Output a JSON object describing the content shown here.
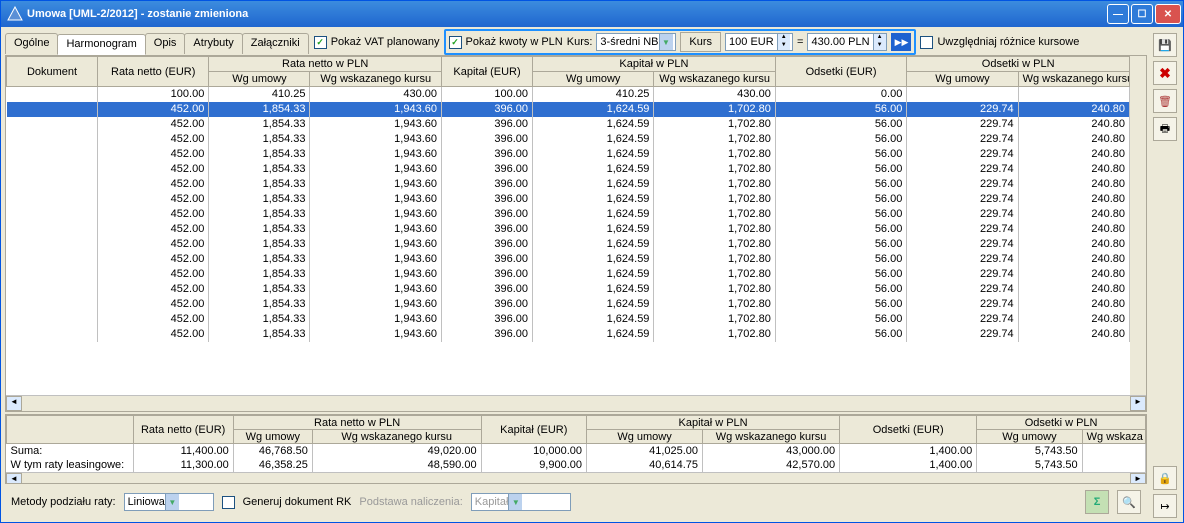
{
  "window": {
    "title": "Umowa [UML-2/2012] - zostanie zmieniona"
  },
  "tabs": [
    "Ogólne",
    "Harmonogram",
    "Opis",
    "Atrybuty",
    "Załączniki"
  ],
  "activeTab": 1,
  "options": {
    "pokaz_vat_label": "Pokaż VAT planowany",
    "pokaz_kwoty_label": "Pokaż kwoty w PLN",
    "kurs_label": "Kurs:",
    "kurs_type": "3-średni NB",
    "kurs_btn": "Kurs",
    "eur_value": "100 EUR",
    "pln_value": "430.00 PLN",
    "uwzgl_label": "Uwzględniaj różnice kursowe"
  },
  "headers": {
    "dokument": "Dokument",
    "rneur": "Rata netto (EUR)",
    "rnpln": "Rata netto w PLN",
    "keur": "Kapitał (EUR)",
    "kpln": "Kapitał w PLN",
    "oeur": "Odsetki (EUR)",
    "opln": "Odsetki w PLN",
    "umowy": "Wg umowy",
    "wsk": "Wg wskazanego kursu"
  },
  "rows": [
    {
      "rneur": "100.00",
      "rnpln1": "410.25",
      "rnpln2": "430.00",
      "keur": "100.00",
      "kpln1": "410.25",
      "kpln2": "430.00",
      "oeur": "0.00",
      "opln1": "",
      "opln2": ""
    },
    {
      "rneur": "452.00",
      "rnpln1": "1,854.33",
      "rnpln2": "1,943.60",
      "keur": "396.00",
      "kpln1": "1,624.59",
      "kpln2": "1,702.80",
      "oeur": "56.00",
      "opln1": "229.74",
      "opln2": "240.80",
      "sel": true
    },
    {
      "rneur": "452.00",
      "rnpln1": "1,854.33",
      "rnpln2": "1,943.60",
      "keur": "396.00",
      "kpln1": "1,624.59",
      "kpln2": "1,702.80",
      "oeur": "56.00",
      "opln1": "229.74",
      "opln2": "240.80"
    },
    {
      "rneur": "452.00",
      "rnpln1": "1,854.33",
      "rnpln2": "1,943.60",
      "keur": "396.00",
      "kpln1": "1,624.59",
      "kpln2": "1,702.80",
      "oeur": "56.00",
      "opln1": "229.74",
      "opln2": "240.80"
    },
    {
      "rneur": "452.00",
      "rnpln1": "1,854.33",
      "rnpln2": "1,943.60",
      "keur": "396.00",
      "kpln1": "1,624.59",
      "kpln2": "1,702.80",
      "oeur": "56.00",
      "opln1": "229.74",
      "opln2": "240.80"
    },
    {
      "rneur": "452.00",
      "rnpln1": "1,854.33",
      "rnpln2": "1,943.60",
      "keur": "396.00",
      "kpln1": "1,624.59",
      "kpln2": "1,702.80",
      "oeur": "56.00",
      "opln1": "229.74",
      "opln2": "240.80"
    },
    {
      "rneur": "452.00",
      "rnpln1": "1,854.33",
      "rnpln2": "1,943.60",
      "keur": "396.00",
      "kpln1": "1,624.59",
      "kpln2": "1,702.80",
      "oeur": "56.00",
      "opln1": "229.74",
      "opln2": "240.80"
    },
    {
      "rneur": "452.00",
      "rnpln1": "1,854.33",
      "rnpln2": "1,943.60",
      "keur": "396.00",
      "kpln1": "1,624.59",
      "kpln2": "1,702.80",
      "oeur": "56.00",
      "opln1": "229.74",
      "opln2": "240.80"
    },
    {
      "rneur": "452.00",
      "rnpln1": "1,854.33",
      "rnpln2": "1,943.60",
      "keur": "396.00",
      "kpln1": "1,624.59",
      "kpln2": "1,702.80",
      "oeur": "56.00",
      "opln1": "229.74",
      "opln2": "240.80"
    },
    {
      "rneur": "452.00",
      "rnpln1": "1,854.33",
      "rnpln2": "1,943.60",
      "keur": "396.00",
      "kpln1": "1,624.59",
      "kpln2": "1,702.80",
      "oeur": "56.00",
      "opln1": "229.74",
      "opln2": "240.80"
    },
    {
      "rneur": "452.00",
      "rnpln1": "1,854.33",
      "rnpln2": "1,943.60",
      "keur": "396.00",
      "kpln1": "1,624.59",
      "kpln2": "1,702.80",
      "oeur": "56.00",
      "opln1": "229.74",
      "opln2": "240.80"
    },
    {
      "rneur": "452.00",
      "rnpln1": "1,854.33",
      "rnpln2": "1,943.60",
      "keur": "396.00",
      "kpln1": "1,624.59",
      "kpln2": "1,702.80",
      "oeur": "56.00",
      "opln1": "229.74",
      "opln2": "240.80"
    },
    {
      "rneur": "452.00",
      "rnpln1": "1,854.33",
      "rnpln2": "1,943.60",
      "keur": "396.00",
      "kpln1": "1,624.59",
      "kpln2": "1,702.80",
      "oeur": "56.00",
      "opln1": "229.74",
      "opln2": "240.80"
    },
    {
      "rneur": "452.00",
      "rnpln1": "1,854.33",
      "rnpln2": "1,943.60",
      "keur": "396.00",
      "kpln1": "1,624.59",
      "kpln2": "1,702.80",
      "oeur": "56.00",
      "opln1": "229.74",
      "opln2": "240.80"
    },
    {
      "rneur": "452.00",
      "rnpln1": "1,854.33",
      "rnpln2": "1,943.60",
      "keur": "396.00",
      "kpln1": "1,624.59",
      "kpln2": "1,702.80",
      "oeur": "56.00",
      "opln1": "229.74",
      "opln2": "240.80"
    },
    {
      "rneur": "452.00",
      "rnpln1": "1,854.33",
      "rnpln2": "1,943.60",
      "keur": "396.00",
      "kpln1": "1,624.59",
      "kpln2": "1,702.80",
      "oeur": "56.00",
      "opln1": "229.74",
      "opln2": "240.80"
    },
    {
      "rneur": "452.00",
      "rnpln1": "1,854.33",
      "rnpln2": "1,943.60",
      "keur": "396.00",
      "kpln1": "1,624.59",
      "kpln2": "1,702.80",
      "oeur": "56.00",
      "opln1": "229.74",
      "opln2": "240.80"
    }
  ],
  "summary_headers": {
    "rneur": "Rata netto (EUR)",
    "rnpln": "Rata netto w PLN",
    "keur": "Kapitał (EUR)",
    "kpln": "Kapitał w PLN",
    "oeur": "Odsetki (EUR)",
    "opln": "Odsetki w PLN",
    "umowy": "Wg umowy",
    "wsk": "Wg wskazanego kursu",
    "wsk_short": "Wg wskaza"
  },
  "summary": [
    {
      "label": "Suma:",
      "rneur": "11,400.00",
      "rnpln1": "46,768.50",
      "rnpln2": "49,020.00",
      "keur": "10,000.00",
      "kpln1": "41,025.00",
      "kpln2": "43,000.00",
      "oeur": "1,400.00",
      "opln1": "5,743.50",
      "opln2": ""
    },
    {
      "label": "W tym raty leasingowe:",
      "rneur": "11,300.00",
      "rnpln1": "46,358.25",
      "rnpln2": "48,590.00",
      "keur": "9,900.00",
      "kpln1": "40,614.75",
      "kpln2": "42,570.00",
      "oeur": "1,400.00",
      "opln1": "5,743.50",
      "opln2": ""
    }
  ],
  "bottom": {
    "metody_label": "Metody podziału raty:",
    "metody_value": "Liniowa",
    "generuj_label": "Generuj dokument RK",
    "podstawa_label": "Podstawa naliczenia:",
    "podstawa_value": "Kapitał"
  },
  "icons": {
    "save": "💾",
    "delete": "✖",
    "trash": "🗑",
    "print": "🖶",
    "lock": "🔒",
    "sigma": "Σ",
    "search": "🔍",
    "exit": "↦"
  }
}
